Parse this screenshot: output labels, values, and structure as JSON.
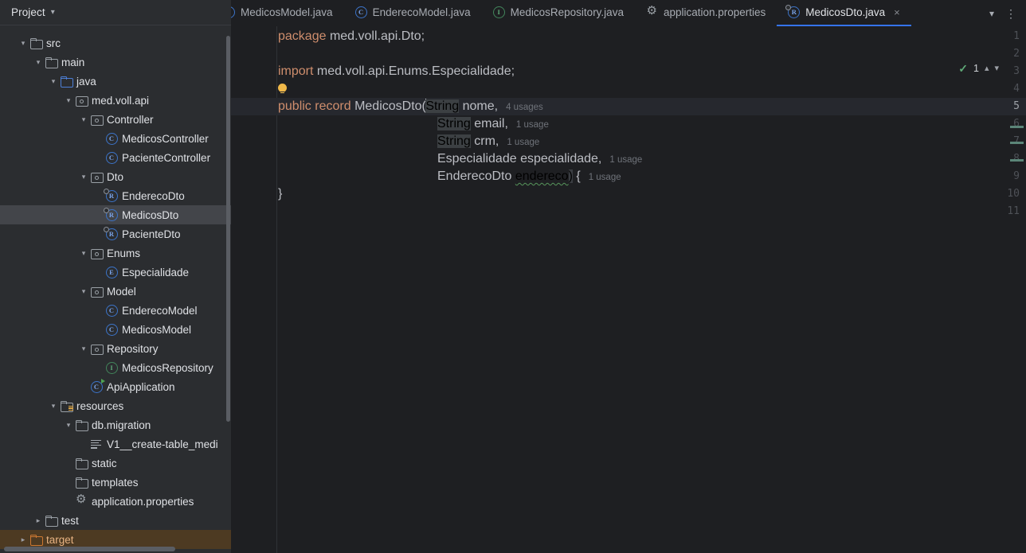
{
  "sidebar": {
    "header": {
      "title": "Project",
      "chevron_icon": "chevron-down-icon"
    },
    "tree": [
      {
        "label": "src",
        "indent": 0,
        "twisty": "⌄",
        "icon": "folder-icon",
        "state": "normal"
      },
      {
        "label": "main",
        "indent": 1,
        "twisty": "⌄",
        "icon": "folder-icon",
        "state": "normal"
      },
      {
        "label": "java",
        "indent": 2,
        "twisty": "⌄",
        "icon": "source-folder-icon",
        "state": "normal"
      },
      {
        "label": "med.voll.api",
        "indent": 3,
        "twisty": "⌄",
        "icon": "package-icon",
        "state": "normal"
      },
      {
        "label": "Controller",
        "indent": 4,
        "twisty": "⌄",
        "icon": "package-icon",
        "state": "normal"
      },
      {
        "label": "MedicosController",
        "indent": 5,
        "twisty": "",
        "icon": "class-icon",
        "state": "normal"
      },
      {
        "label": "PacienteController",
        "indent": 5,
        "twisty": "",
        "icon": "class-icon",
        "state": "normal"
      },
      {
        "label": "Dto",
        "indent": 4,
        "twisty": "⌄",
        "icon": "package-icon",
        "state": "normal"
      },
      {
        "label": "EnderecoDto",
        "indent": 5,
        "twisty": "",
        "icon": "record-icon",
        "state": "normal"
      },
      {
        "label": "MedicosDto",
        "indent": 5,
        "twisty": "",
        "icon": "record-icon",
        "state": "selected"
      },
      {
        "label": "PacienteDto",
        "indent": 5,
        "twisty": "",
        "icon": "record-icon",
        "state": "normal"
      },
      {
        "label": "Enums",
        "indent": 4,
        "twisty": "⌄",
        "icon": "package-icon",
        "state": "normal"
      },
      {
        "label": "Especialidade",
        "indent": 5,
        "twisty": "",
        "icon": "enum-icon",
        "state": "normal"
      },
      {
        "label": "Model",
        "indent": 4,
        "twisty": "⌄",
        "icon": "package-icon",
        "state": "normal"
      },
      {
        "label": "EnderecoModel",
        "indent": 5,
        "twisty": "",
        "icon": "class-icon",
        "state": "normal"
      },
      {
        "label": "MedicosModel",
        "indent": 5,
        "twisty": "",
        "icon": "class-icon",
        "state": "normal"
      },
      {
        "label": "Repository",
        "indent": 4,
        "twisty": "⌄",
        "icon": "package-icon",
        "state": "normal"
      },
      {
        "label": "MedicosRepository",
        "indent": 5,
        "twisty": "",
        "icon": "interface-icon",
        "state": "normal"
      },
      {
        "label": "ApiApplication",
        "indent": 4,
        "twisty": "",
        "icon": "runnable-class-icon",
        "state": "normal"
      },
      {
        "label": "resources",
        "indent": 2,
        "twisty": "⌄",
        "icon": "resources-folder-icon",
        "state": "normal"
      },
      {
        "label": "db.migration",
        "indent": 3,
        "twisty": "⌄",
        "icon": "folder-icon",
        "state": "normal"
      },
      {
        "label": "V1__create-table_medi",
        "indent": 4,
        "twisty": "",
        "icon": "sql-file-icon",
        "state": "normal"
      },
      {
        "label": "static",
        "indent": 3,
        "twisty": "",
        "icon": "folder-icon",
        "state": "normal"
      },
      {
        "label": "templates",
        "indent": 3,
        "twisty": "",
        "icon": "folder-icon",
        "state": "normal"
      },
      {
        "label": "application.properties",
        "indent": 3,
        "twisty": "",
        "icon": "properties-icon",
        "state": "normal"
      },
      {
        "label": "test",
        "indent": 1,
        "twisty": "›",
        "icon": "folder-icon",
        "state": "normal"
      },
      {
        "label": "target",
        "indent": 0,
        "twisty": "›",
        "icon": "excluded-folder-icon",
        "state": "excluded"
      }
    ]
  },
  "tabs": [
    {
      "label": "MedicosModel.java",
      "icon": "class-icon",
      "active": false,
      "closable": false
    },
    {
      "label": "EnderecoModel.java",
      "icon": "class-icon",
      "active": false,
      "closable": false
    },
    {
      "label": "MedicosRepository.java",
      "icon": "interface-icon",
      "active": false,
      "closable": false
    },
    {
      "label": "application.properties",
      "icon": "properties-icon",
      "active": false,
      "closable": false
    },
    {
      "label": "MedicosDto.java",
      "icon": "record-icon",
      "active": true,
      "closable": true
    }
  ],
  "tabbar_actions": {
    "close_glyph": "×",
    "dropdown_icon": "chevron-down-icon",
    "kebab_icon": "more-vertical-icon"
  },
  "editor": {
    "line_numbers": [
      "1",
      "2",
      "3",
      "4",
      "5",
      "6",
      "7",
      "8",
      "9",
      "10",
      "11"
    ],
    "current_line": 5,
    "lines": [
      {
        "n": 1,
        "tokens": [
          {
            "t": "package",
            "c": "kw"
          },
          {
            "t": " med.voll.api.Dto;",
            "c": "plain"
          }
        ]
      },
      {
        "n": 2,
        "tokens": []
      },
      {
        "n": 3,
        "tokens": [
          {
            "t": "import",
            "c": "kw"
          },
          {
            "t": " med.voll.api.Enums.Especialidade;",
            "c": "plain"
          }
        ]
      },
      {
        "n": 4,
        "tokens": [],
        "bulb": true
      },
      {
        "n": 5,
        "tokens": [
          {
            "t": "public",
            "c": "kw"
          },
          {
            "t": " ",
            "c": "plain"
          },
          {
            "t": "record",
            "c": "kw"
          },
          {
            "t": " MedicosDto",
            "c": "plain"
          },
          {
            "t": "(",
            "c": "brk"
          },
          {
            "t": "String",
            "c": "hl"
          },
          {
            "t": " nome,",
            "c": "plain"
          }
        ],
        "hint": "4 usages"
      },
      {
        "n": 6,
        "tokens": [
          {
            "t": "String",
            "c": "hl"
          },
          {
            "t": " email,",
            "c": "plain"
          }
        ],
        "hint": "1 usage",
        "indent": true
      },
      {
        "n": 7,
        "tokens": [
          {
            "t": "String",
            "c": "hl"
          },
          {
            "t": " crm,",
            "c": "plain"
          }
        ],
        "hint": "1 usage",
        "indent": true
      },
      {
        "n": 8,
        "tokens": [
          {
            "t": "Especialidade especialidade,",
            "c": "plain"
          }
        ],
        "hint": "1 usage",
        "indent": true
      },
      {
        "n": 9,
        "tokens": [
          {
            "t": "EnderecoDto ",
            "c": "plain"
          },
          {
            "t": "endereco",
            "c": "squig"
          },
          {
            "t": ")",
            "c": "brk"
          },
          {
            "t": " {",
            "c": "plain"
          }
        ],
        "hint": "1 usage",
        "indent": true
      },
      {
        "n": 10,
        "tokens": [
          {
            "t": "}",
            "c": "plain"
          }
        ]
      },
      {
        "n": 11,
        "tokens": []
      }
    ],
    "inspection_widget": {
      "check_icon": "green-check-icon",
      "count": "1",
      "up_icon": "chevron-up-icon",
      "down_icon": "chevron-down-icon"
    },
    "markers": [
      158,
      178,
      200
    ]
  },
  "colors": {
    "accent": "#3574f0",
    "keyword": "#cf8e6d",
    "text": "#bcbec4",
    "sidebar_bg": "#2b2d30",
    "editor_bg": "#1e1f22",
    "excluded": "#4d3a22",
    "marker": "#5b8578"
  }
}
